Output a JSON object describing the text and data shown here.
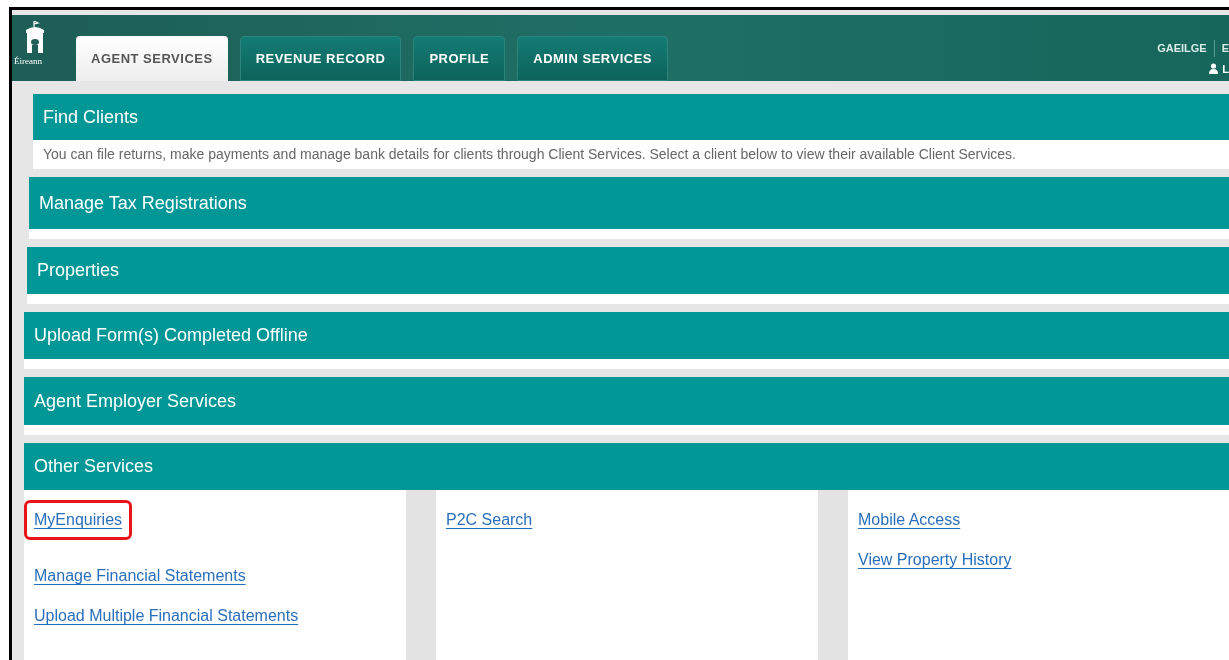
{
  "header": {
    "logo_text": "Éireann",
    "tabs": [
      {
        "label": "AGENT SERVICES",
        "selected": true
      },
      {
        "label": "REVENUE RECORD",
        "selected": false
      },
      {
        "label": "PROFILE",
        "selected": false
      },
      {
        "label": "ADMIN SERVICES",
        "selected": false
      }
    ],
    "language_links": [
      "GAEILGE",
      "E"
    ],
    "user_label": "L"
  },
  "panels": [
    {
      "title": "Find Clients",
      "description": "You can file returns, make payments and manage bank details for clients through Client Services. Select a client below to view their available Client Services."
    },
    {
      "title": "Manage Tax Registrations"
    },
    {
      "title": "Properties"
    },
    {
      "title": "Upload Form(s) Completed Offline"
    },
    {
      "title": "Agent Employer Services"
    }
  ],
  "other_services": {
    "title": "Other Services",
    "columns": [
      [
        {
          "label": "MyEnquiries",
          "highlighted": true
        },
        {
          "label": "Manage Financial Statements",
          "highlighted": false
        },
        {
          "label": "Upload Multiple Financial Statements",
          "highlighted": false
        }
      ],
      [
        {
          "label": "P2C Search",
          "highlighted": false
        }
      ],
      [
        {
          "label": "Mobile Access",
          "highlighted": false
        },
        {
          "label": "View Property History",
          "highlighted": false
        }
      ]
    ]
  }
}
